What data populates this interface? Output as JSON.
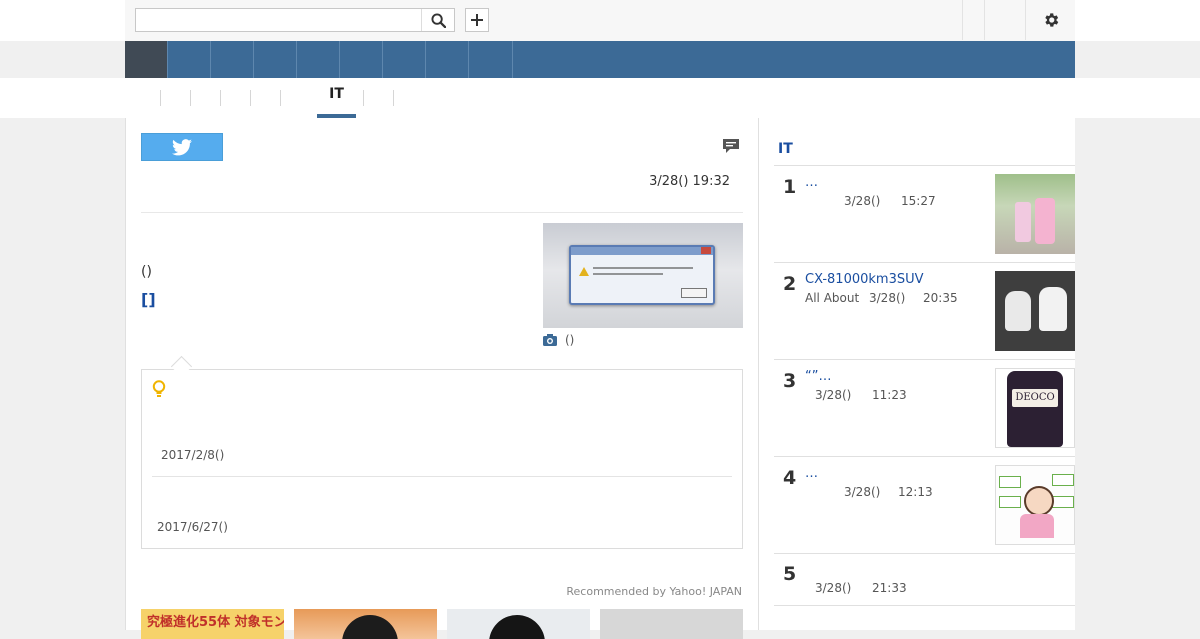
{
  "search": {
    "placeholder": ""
  },
  "article": {
    "date": "3/28() 19:32",
    "source_line": "()",
    "link_label": "[]",
    "photo_caption": "()",
    "notice": {
      "date_1": "2017/2/8()",
      "date_2": "2017/6/27()"
    },
    "recommended_label": "Recommended by Yahoo! JAPAN",
    "recommend_thumbs": [
      {
        "text": "究極進化55体 対象モンス"
      }
    ]
  },
  "tabs": {
    "active_label": "IT"
  },
  "ranking": {
    "title": "IT",
    "items": [
      {
        "num": "1",
        "title": "…",
        "source": "",
        "date": "3/28()",
        "time": "15:27"
      },
      {
        "num": "2",
        "title": "CX-81000km3SUV",
        "source": "All About",
        "date": "3/28()",
        "time": "20:35"
      },
      {
        "num": "3",
        "title": "“”…",
        "source": "",
        "date": "3/28()",
        "time": "11:23"
      },
      {
        "num": "4",
        "title": "…",
        "source": "",
        "date": "3/28()",
        "time": "12:13"
      },
      {
        "num": "5",
        "title": "",
        "source": "",
        "date": "3/28()",
        "time": "21:33"
      }
    ],
    "thumb_3_label": "DEOCO"
  },
  "colors": {
    "nav_blue": "#3c6a96",
    "nav_active": "#404a55",
    "link_blue": "#1a4ea0",
    "twitter_blue": "#55acee"
  },
  "icons": {
    "search": "search-icon",
    "plus": "plus-icon",
    "settings": "gear-icon",
    "twitter": "twitter-icon",
    "comment": "comment-icon",
    "camera": "camera-icon",
    "notice": "lightbulb-icon"
  }
}
